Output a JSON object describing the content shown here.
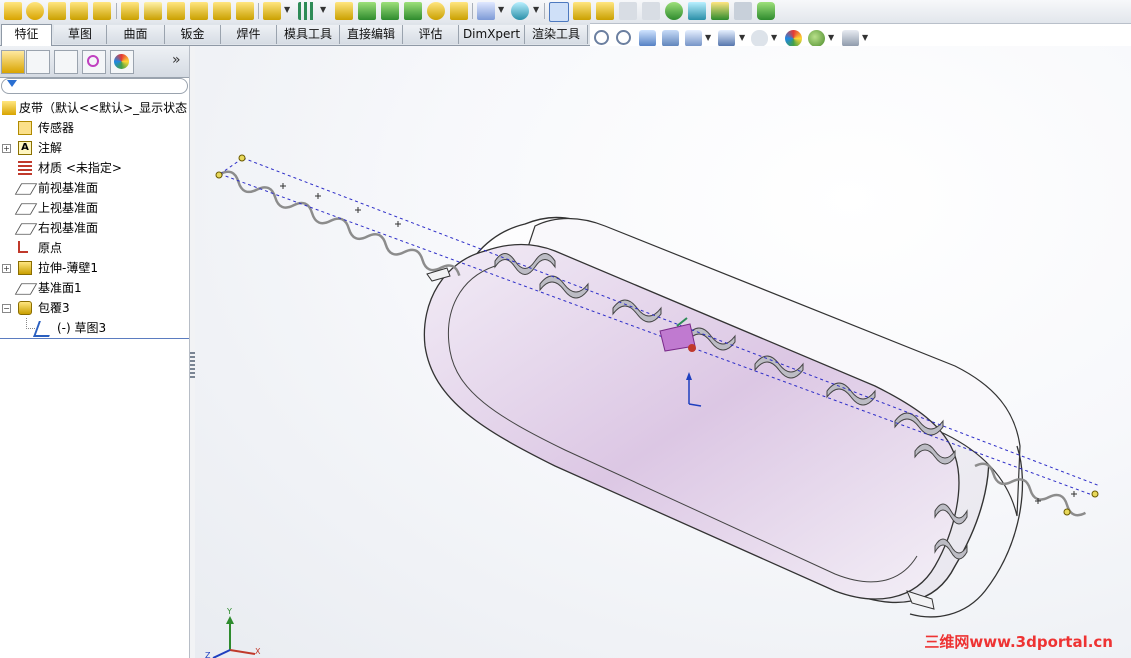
{
  "tabs": [
    {
      "label": "特征",
      "active": true
    },
    {
      "label": "草图"
    },
    {
      "label": "曲面"
    },
    {
      "label": "钣金"
    },
    {
      "label": "焊件"
    },
    {
      "label": "模具工具"
    },
    {
      "label": "直接编辑"
    },
    {
      "label": "评估"
    },
    {
      "label": "DimXpert"
    },
    {
      "label": "渲染工具"
    }
  ],
  "panel": {
    "more_glyph": "»",
    "filter_icon": "funnel-icon"
  },
  "tree": {
    "root": "皮带（默认<<默认>_显示状态",
    "items": [
      {
        "label": "传感器",
        "icon": "sensor-icon",
        "expander": false
      },
      {
        "label": "注解",
        "icon": "annotation-icon",
        "expander": true
      },
      {
        "label": "材质 <未指定>",
        "icon": "material-icon",
        "expander": false
      },
      {
        "label": "前视基准面",
        "icon": "plane-icon",
        "expander": false
      },
      {
        "label": "上视基准面",
        "icon": "plane-icon",
        "expander": false
      },
      {
        "label": "右视基准面",
        "icon": "plane-icon",
        "expander": false
      },
      {
        "label": "原点",
        "icon": "origin-icon",
        "expander": false
      },
      {
        "label": "拉伸-薄壁1",
        "icon": "extrude-icon",
        "expander": true
      },
      {
        "label": "基准面1",
        "icon": "plane-icon",
        "expander": false
      },
      {
        "label": "包覆3",
        "icon": "wrap-icon",
        "expander": true
      },
      {
        "label": "(-) 草图3",
        "icon": "sketch-icon",
        "expander": false
      }
    ]
  },
  "triad": {
    "y_label": "Y",
    "x_label": "X",
    "z_label": "Z"
  },
  "watermark": "三维网www.3dportal.cn",
  "colors": {
    "accent": "#3a6fc4",
    "wrap_face": "#c07ad0",
    "watermark": "#ee3333"
  }
}
